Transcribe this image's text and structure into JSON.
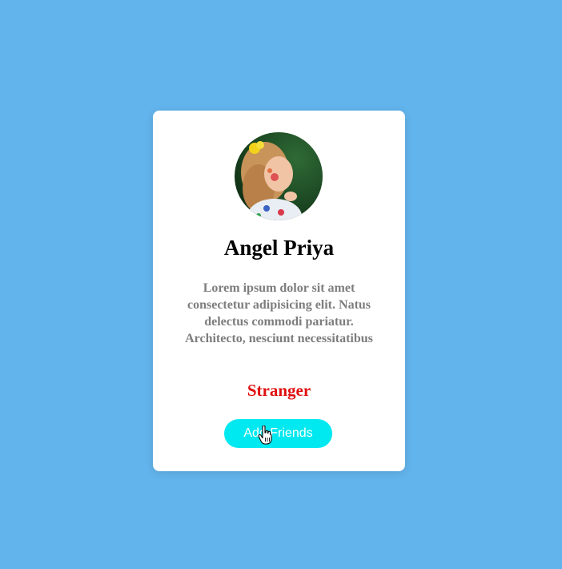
{
  "profile": {
    "avatar_icon": "child-portrait-photo",
    "name": "Angel Priya",
    "bio": "Lorem ipsum dolor sit amet consectetur adipisicing elit. Natus delectus commodi pariatur. Architecto, nesciunt necessitatibus",
    "status": "Stranger",
    "add_button_label": "Add Friends"
  },
  "colors": {
    "background": "#62b4ec",
    "card": "#ffffff",
    "status": "#e01010",
    "button": "#00e8f0",
    "button_text": "#ffffff",
    "bio_text": "#7d7d7d"
  },
  "cursor_icon": "hand-pointer-icon"
}
